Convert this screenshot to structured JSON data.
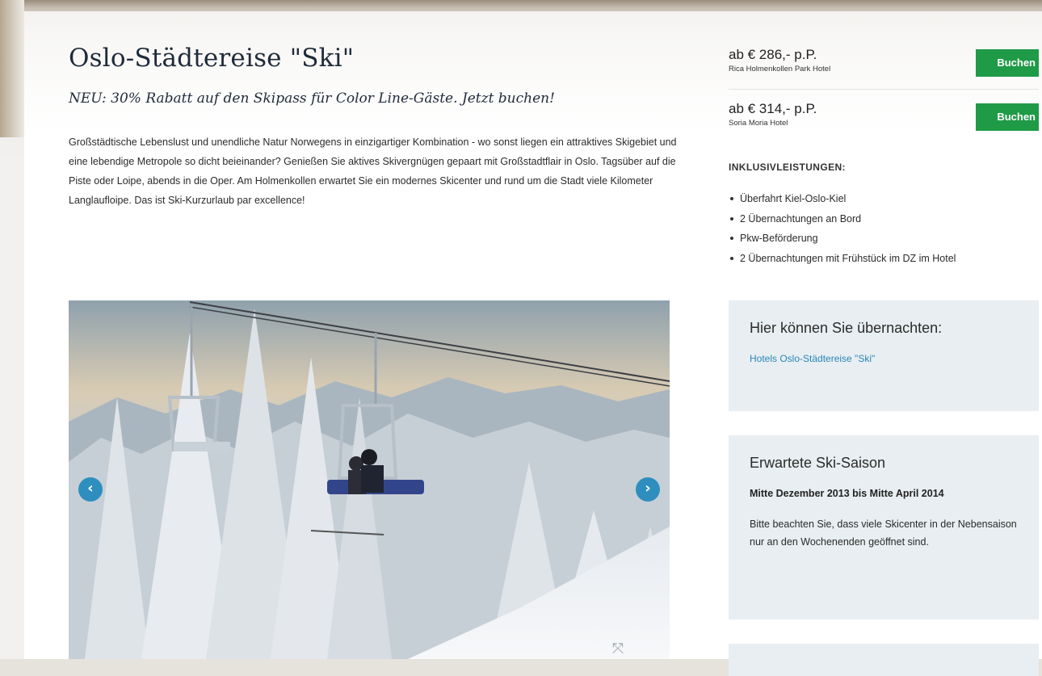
{
  "trip": {
    "title": "Oslo-Städtereise \"Ski\"",
    "subtitle": "NEU: 30% Rabatt auf den Skipass für Color Line-Gäste. Jetzt buchen!",
    "intro": "Großstädtische Lebenslust und unendliche Natur Norwegens in einzigartiger Kombination - wo sonst liegen ein attraktives Skigebiet und eine lebendige Metropole so dicht beieinander? Genießen Sie aktives Skivergnügen gepaart mit Großstadtflair in Oslo. Tagsüber auf die Piste oder Loipe, abends in die Oper. Am Holmenkollen erwartet Sie ein modernes Skicenter und rund um die Stadt viele Kilometer Langlaufloipe. Das ist Ski-Kurzurlaub par excellence!"
  },
  "offers": [
    {
      "price": "ab € 286,- p.P.",
      "hotel": "Rica Holmenkollen Park Hotel",
      "button": "Buchen"
    },
    {
      "price": "ab € 314,- p.P.",
      "hotel": "Soria Moria Hotel",
      "button": "Buchen"
    }
  ],
  "inclusions": {
    "heading": "INKLUSIVLEISTUNGEN:",
    "items": [
      "Überfahrt Kiel-Oslo-Kiel",
      "2 Übernachtungen an Bord",
      "Pkw-Beförderung",
      "2 Übernachtungen mit Frühstück im DZ im Hotel"
    ]
  },
  "slideshow": {
    "prev_icon": "‹",
    "next_icon": "›",
    "fullscreen_icon": "⤧"
  },
  "stay_box": {
    "title": "Hier können Sie übernachten:",
    "link": "Hotels Oslo-Städtereise \"Ski\""
  },
  "season_box": {
    "title": "Erwartete Ski-Saison",
    "period": "Mitte Dezember 2013 bis Mitte April 2014",
    "note": "Bitte beachten Sie, dass viele Skicenter in der Nebensaison nur an den Wochenenden geöffnet sind."
  },
  "colors": {
    "button_green": "#1f9a47",
    "link_blue": "#2a86b8",
    "box_bg": "#e8eef1",
    "arrow_blue": "#2e8fbf"
  }
}
